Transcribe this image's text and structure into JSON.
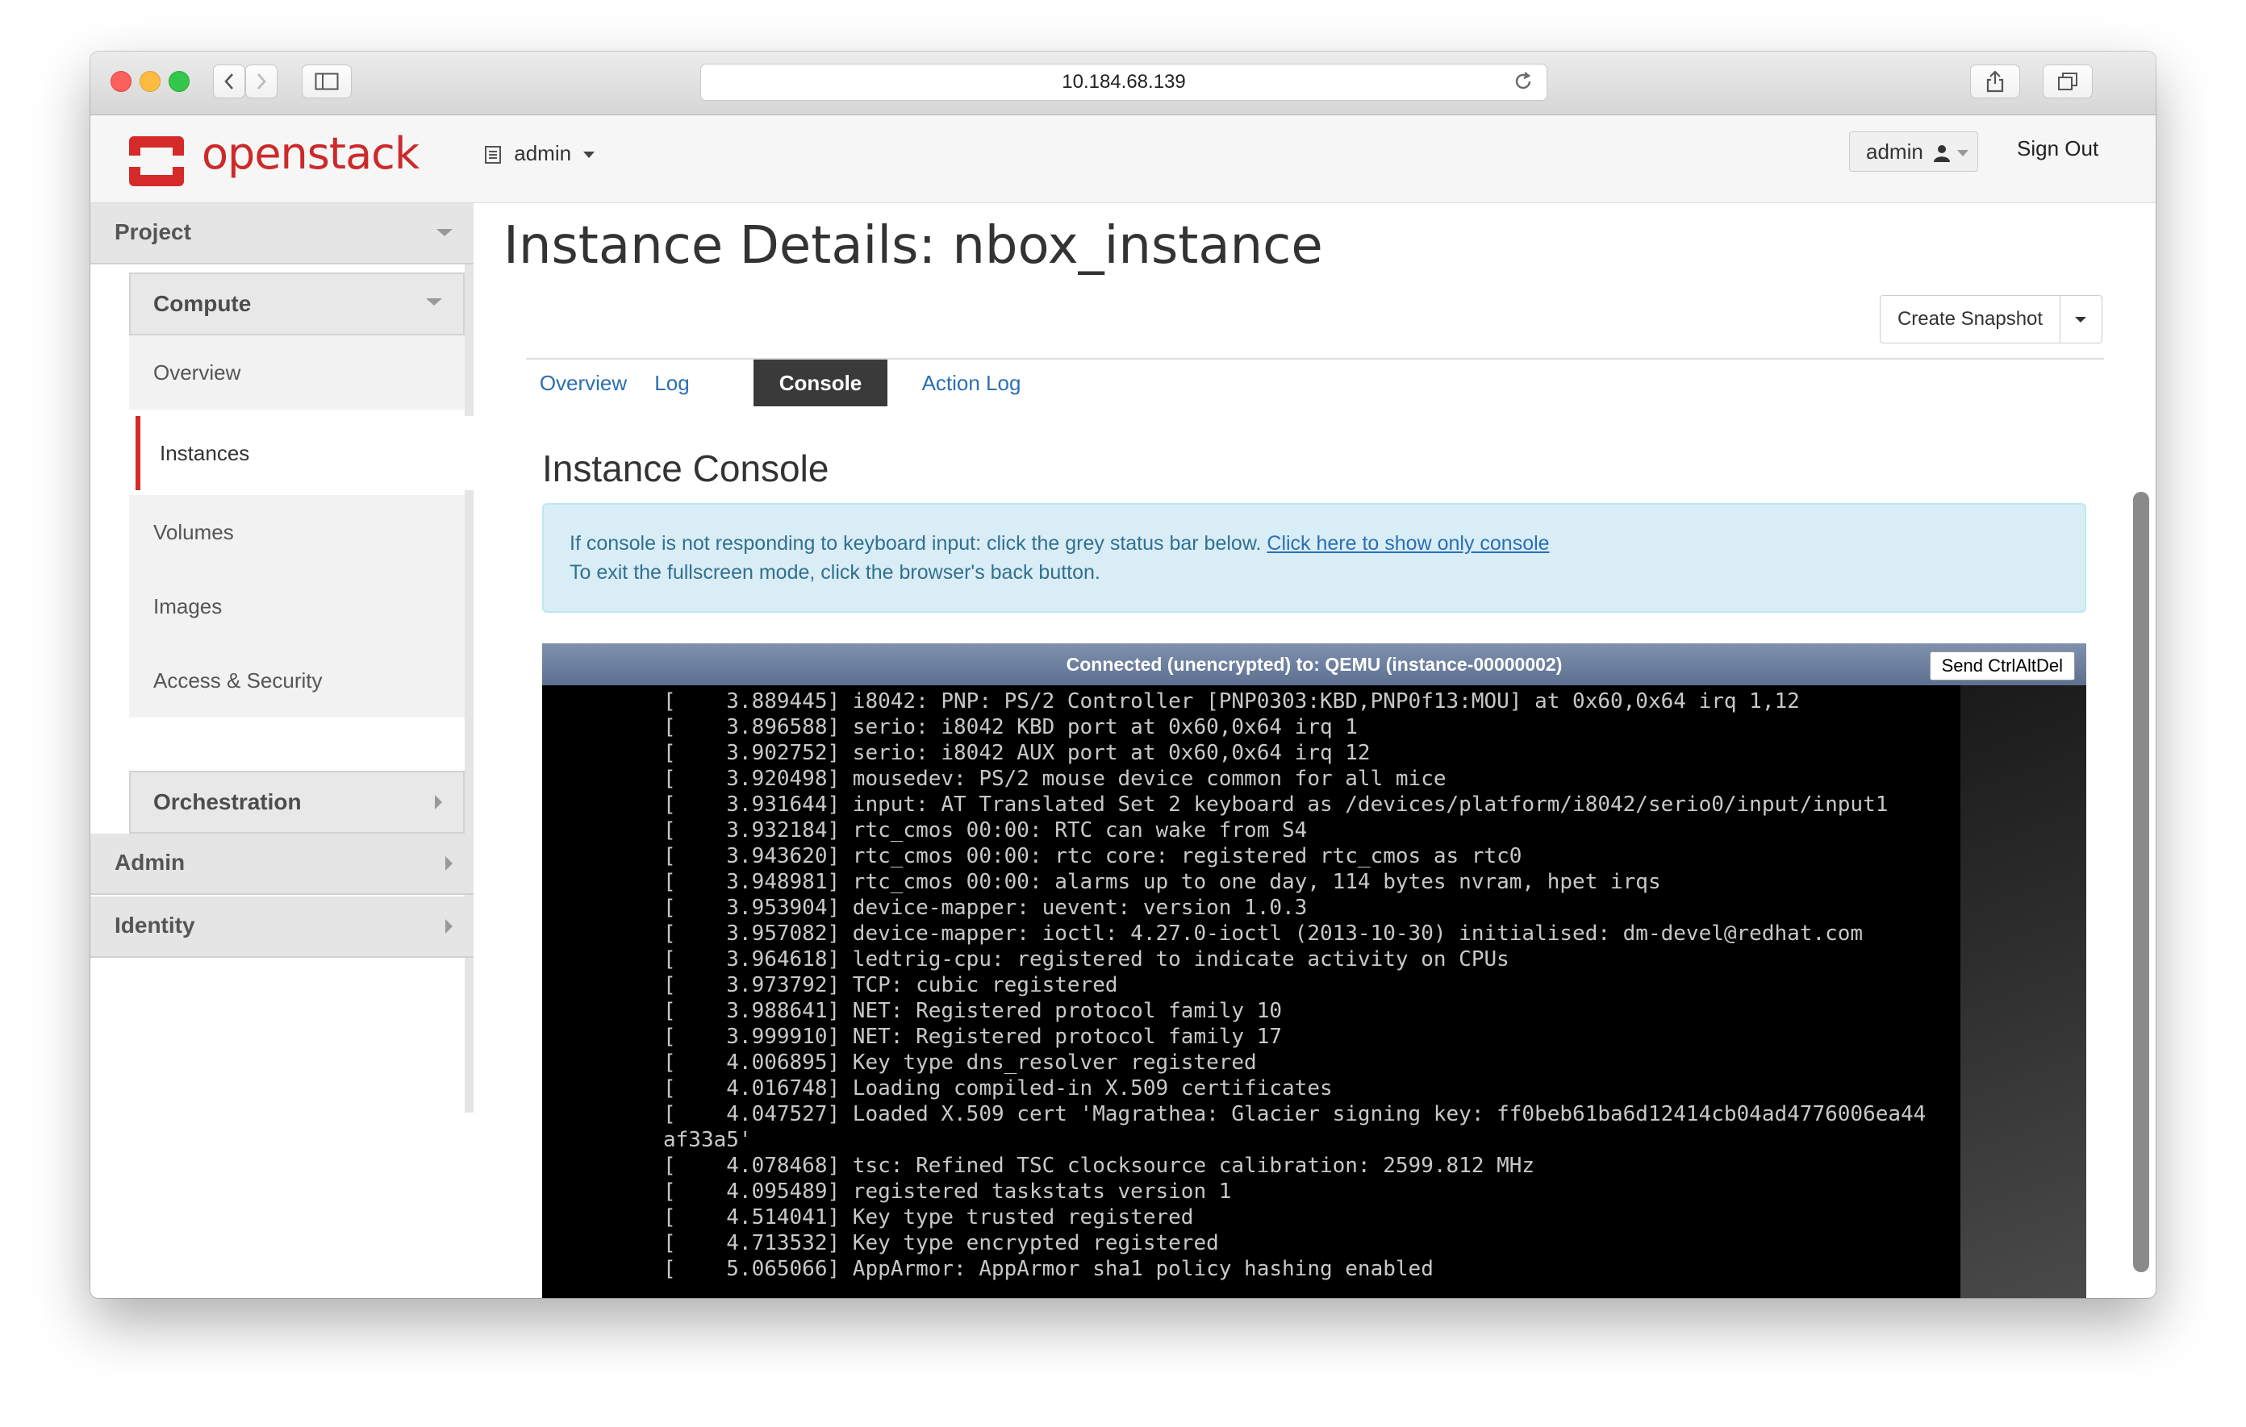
{
  "browser": {
    "url": "10.184.68.139"
  },
  "header": {
    "logo_text": "openstack",
    "project_selector": "admin",
    "user_menu": "admin",
    "sign_out": "Sign Out"
  },
  "sidebar": {
    "project": "Project",
    "compute": "Compute",
    "items": [
      "Overview",
      "Instances",
      "Volumes",
      "Images",
      "Access & Security"
    ],
    "active_item": "Instances",
    "orchestration": "Orchestration",
    "admin": "Admin",
    "identity": "Identity"
  },
  "main": {
    "page_title": "Instance Details: nbox_instance",
    "create_snapshot": "Create Snapshot",
    "tabs": [
      "Overview",
      "Log",
      "Console",
      "Action Log"
    ],
    "active_tab": "Console",
    "section_title": "Instance Console",
    "alert_line1": "If console is not responding to keyboard input: click the grey status bar below.",
    "alert_link": "Click here to show only console",
    "alert_line2": "To exit the fullscreen mode, click the browser's back button."
  },
  "console": {
    "status": "Connected (unencrypted) to: QEMU (instance-00000002)",
    "send_ctrl_alt_del": "Send CtrlAltDel",
    "lines": [
      "[    3.889445] i8042: PNP: PS/2 Controller [PNP0303:KBD,PNP0f13:MOU] at 0x60,0x64 irq 1,12",
      "[    3.896588] serio: i8042 KBD port at 0x60,0x64 irq 1",
      "[    3.902752] serio: i8042 AUX port at 0x60,0x64 irq 12",
      "[    3.920498] mousedev: PS/2 mouse device common for all mice",
      "[    3.931644] input: AT Translated Set 2 keyboard as /devices/platform/i8042/serio0/input/input1",
      "[    3.932184] rtc_cmos 00:00: RTC can wake from S4",
      "[    3.943620] rtc_cmos 00:00: rtc core: registered rtc_cmos as rtc0",
      "[    3.948981] rtc_cmos 00:00: alarms up to one day, 114 bytes nvram, hpet irqs",
      "[    3.953904] device-mapper: uevent: version 1.0.3",
      "[    3.957082] device-mapper: ioctl: 4.27.0-ioctl (2013-10-30) initialised: dm-devel@redhat.com",
      "[    3.964618] ledtrig-cpu: registered to indicate activity on CPUs",
      "[    3.973792] TCP: cubic registered",
      "[    3.988641] NET: Registered protocol family 10",
      "[    3.999910] NET: Registered protocol family 17",
      "[    4.006895] Key type dns_resolver registered",
      "[    4.016748] Loading compiled-in X.509 certificates",
      "[    4.047527] Loaded X.509 cert 'Magrathea: Glacier signing key: ff0beb61ba6d12414cb04ad4776006ea44",
      "af33a5'",
      "[    4.078468] tsc: Refined TSC clocksource calibration: 2599.812 MHz",
      "[    4.095489] registered taskstats version 1",
      "[    4.514041] Key type trusted registered",
      "[    4.713532] Key type encrypted registered",
      "[    5.065066] AppArmor: AppArmor sha1 policy hashing enabled"
    ]
  },
  "colors": {
    "brand_red": "#d42a2a",
    "link_blue": "#2a6fb4",
    "alert_bg": "#d9edf7",
    "console_bar": "#6d7f9f"
  }
}
